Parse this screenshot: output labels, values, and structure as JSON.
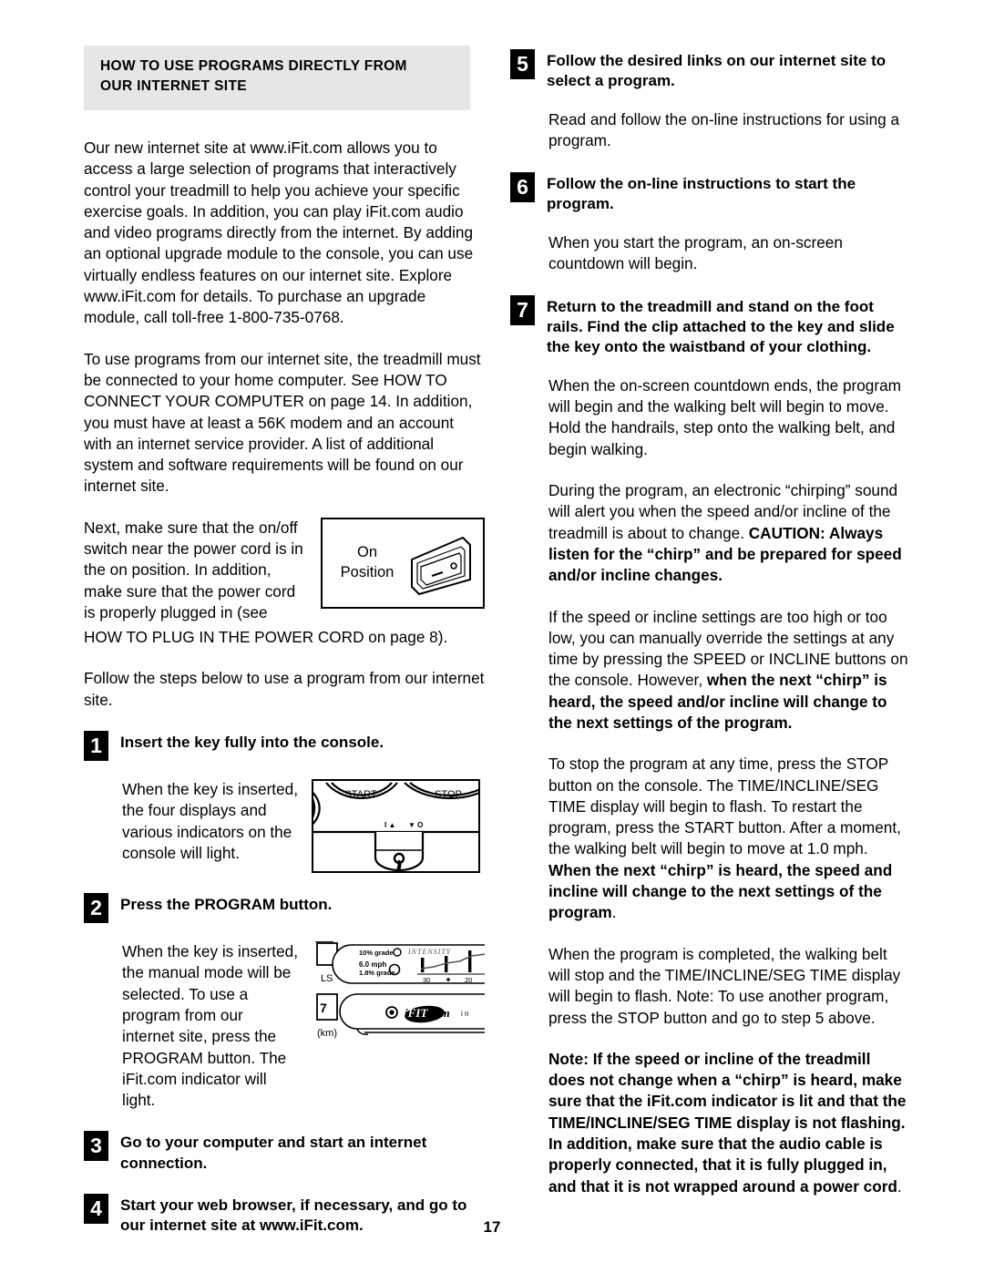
{
  "page": {
    "number": "17"
  },
  "left": {
    "section_header": {
      "line1": "HOW TO USE PROGRAMS DIRECTLY FROM",
      "line2": "OUR INTERNET SITE"
    },
    "para_intro": "Our new internet site at www.iFit.com allows you to access a large selection of programs that interactively control your treadmill to help you achieve your specific exercise goals. In addition, you can play iFit.com audio and video programs directly from the internet. By adding an optional upgrade module to the console, you can use virtually endless features on our internet site. Explore www.iFit.com for details. To purchase an upgrade module, call toll-free 1-800-735-0768.",
    "para_requirements": "To use programs from our internet site, the treadmill must be connected to your home computer. See HOW TO CONNECT YOUR COMPUTER on page 14. In addition, you must have at least a 56K modem and an account with an internet service provider. A list of additional system and software requirements will be found on our internet site.",
    "para_switch": "Next, make sure that the on/off switch near the power cord is in the on position. In addition, make sure that the power cord is properly plugged in (see",
    "para_switch_tail": "HOW TO PLUG IN THE POWER CORD on page 8).",
    "figure_onposition": {
      "label_line1": "On",
      "label_line2": "Position"
    },
    "para_follow_steps": "Follow the steps below to use a program from our internet site.",
    "steps": [
      {
        "number": "1",
        "heading": "Insert the key fully into the console.",
        "body": "When the key is inserted, the four displays and various indicators on the console will light."
      },
      {
        "number": "2",
        "heading": "Press the PROGRAM button.",
        "body": "When the key is inserted, the manual mode will be selected. To use a program from our internet site, press the PROGRAM button. The iFit.com indicator will light."
      },
      {
        "number": "3",
        "heading": "Go to your computer and start an internet connection.",
        "body": ""
      },
      {
        "number": "4",
        "heading": "Start your web browser, if necessary, and go to our internet site at www.iFit.com.",
        "body": ""
      }
    ],
    "figure_console1": {
      "start_label": "START",
      "stop_label": "STOP"
    },
    "figure_console2": {
      "grade_top": "10% grade",
      "intensity": "INTENSITY",
      "speed": "6.0 mph",
      "grade_bottom": "1.8% grade",
      "tick_30": "30",
      "tick_20": "20",
      "ls_label": "LS",
      "km_label": "(km)",
      "logo": "iFIT.com",
      "in_label": "i n"
    }
  },
  "right": {
    "step5": {
      "number": "5",
      "heading": "Follow the desired links on our internet site to select a program.",
      "body": "Read and follow the on-line instructions for using a program."
    },
    "step6": {
      "number": "6",
      "heading": "Follow the on-line instructions to start the program.",
      "body": "When you start the program, an on-screen countdown will begin."
    },
    "step7": {
      "number": "7",
      "heading": "Return to the treadmill and stand on the foot rails. Find the clip attached to the key and slide the key onto the waistband of your clothing.",
      "body": "When the on-screen countdown ends, the program will begin and the walking belt will begin to move. Hold the handrails, step onto the walking belt, and begin walking."
    },
    "para_chirp_normal": "During the program, an electronic “chirping” sound will alert you when the speed and/or incline of the treadmill is about to change. ",
    "para_chirp_bold": "CAUTION: Always listen for the “chirp” and be prepared for speed and/or incline changes.",
    "para_override_normal": "If the speed or incline settings are too high or too low, you can manually override the settings at any time by pressing the SPEED or INCLINE buttons on the console. However, ",
    "para_override_bold": "when the next “chirp” is heard, the speed and/or incline will change to the next settings of the program.",
    "para_stop_normal": "To stop the program at any time, press the STOP button on the console. The TIME/INCLINE/SEG TIME display will begin to flash. To restart the program, press the START button. After a moment, the walking belt will begin to move at 1.0 mph. ",
    "para_stop_bold": "When the next “chirp” is heard, the speed and incline will change to the next settings of the program",
    "para_stop_tail": ".",
    "para_completed": "When the program is completed, the walking belt will stop and the TIME/INCLINE/SEG TIME display will begin to flash. Note: To use another program, press the STOP button and go to step 5 above.",
    "para_note_bold": "Note: If the speed or incline of the treadmill does not change when a “chirp” is heard, make sure that the iFit.com indicator is lit and that the TIME/INCLINE/SEG TIME display is not flashing. In addition, make sure that the audio cable is properly connected, that it is fully plugged in, and that it is not wrapped around a power cord",
    "para_note_tail": "."
  }
}
